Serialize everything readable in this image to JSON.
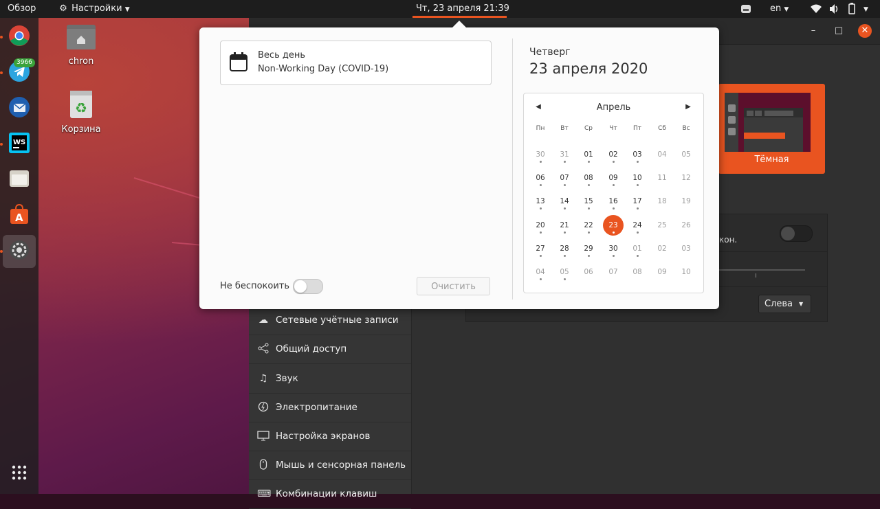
{
  "topbar": {
    "activities": "Обзор",
    "app_menu": "Настройки",
    "clock": "Чт, 23 апреля  21:39",
    "language": "en"
  },
  "dock": {
    "telegram_badge": "3966"
  },
  "desktop": {
    "icons": [
      {
        "label": "chron"
      },
      {
        "label": "Корзина"
      }
    ]
  },
  "settings": {
    "sidebar": [
      {
        "label": "Сетевые учётные записи",
        "icon": "cloud-icon"
      },
      {
        "label": "Общий доступ",
        "icon": "share-icon"
      },
      {
        "label": "Звук",
        "icon": "music-note-icon"
      },
      {
        "label": "Электропитание",
        "icon": "power-icon"
      },
      {
        "label": "Настройка экранов",
        "icon": "display-icon"
      },
      {
        "label": "Мышь и сенсорная панель",
        "icon": "mouse-icon"
      },
      {
        "label": "Комбинации клавиш",
        "icon": "keyboard-icon"
      }
    ],
    "theme_label": "Тёмная",
    "partial_text": "кон.",
    "dock_position": "Слева"
  },
  "popover": {
    "event": {
      "title": "Весь день",
      "description": "Non-Working Day (COVID-19)"
    },
    "dnd_label": "Не беспокоить",
    "dnd_enabled": false,
    "clear_label": "Очистить",
    "weekday": "Четверг",
    "date": "23 апреля 2020",
    "calendar": {
      "month": "Апрель",
      "weekdays": [
        "Пн",
        "Вт",
        "Ср",
        "Чт",
        "Пт",
        "Сб",
        "Вс"
      ],
      "weeks": [
        [
          "30",
          "31",
          "01",
          "02",
          "03",
          "04",
          "05"
        ],
        [
          "06",
          "07",
          "08",
          "09",
          "10",
          "11",
          "12"
        ],
        [
          "13",
          "14",
          "15",
          "16",
          "17",
          "18",
          "19"
        ],
        [
          "20",
          "21",
          "22",
          "23",
          "24",
          "25",
          "26"
        ],
        [
          "27",
          "28",
          "29",
          "30",
          "01",
          "02",
          "03"
        ],
        [
          "04",
          "05",
          "06",
          "07",
          "08",
          "09",
          "10"
        ]
      ],
      "today": "23",
      "accent": "#e95420"
    }
  }
}
